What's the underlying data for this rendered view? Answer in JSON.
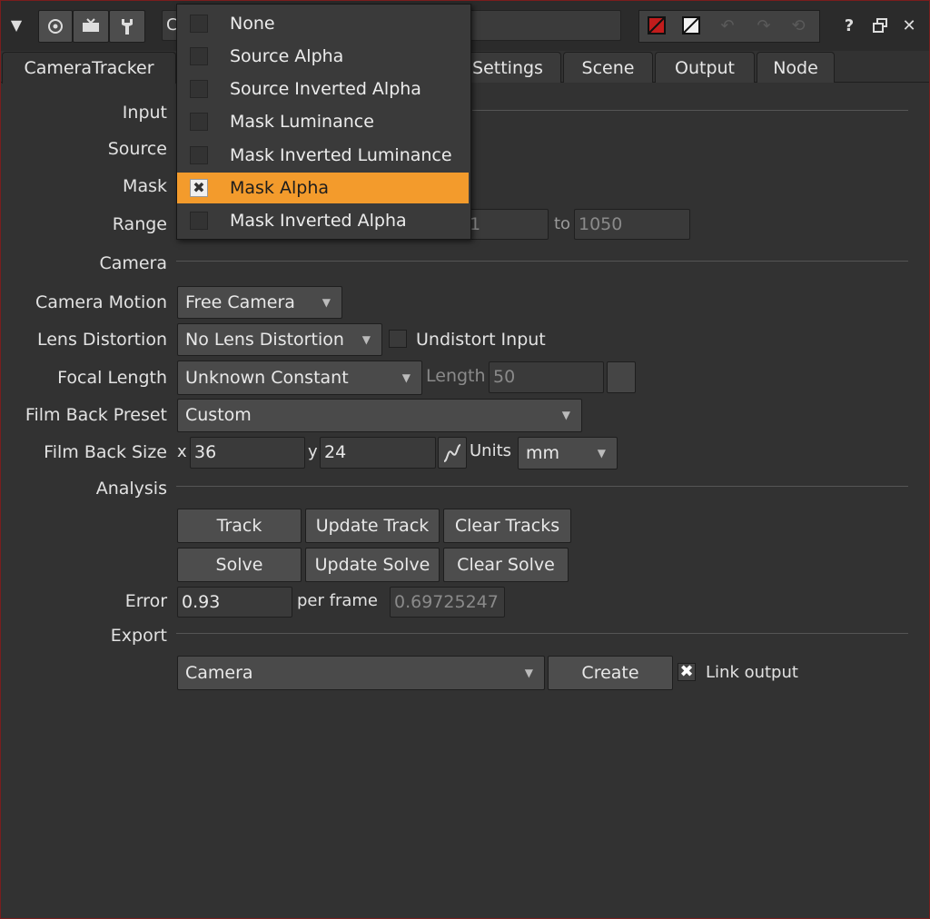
{
  "toolbar": {
    "node_name": "C",
    "icons": [
      "collapse-triangle-icon",
      "circle-target-icon",
      "tv-icon",
      "wrench-icon",
      "red-swatch-icon",
      "white-swatch-icon",
      "undo-icon",
      "redo-icon",
      "revert-icon",
      "help-icon",
      "float-icon",
      "close-icon"
    ],
    "help_label": "?",
    "close_label": "✕"
  },
  "tabs": [
    {
      "label": "CameraTracker",
      "active": true
    },
    {
      "label": "Settings",
      "active": false
    },
    {
      "label": "Scene",
      "active": false
    },
    {
      "label": "Output",
      "active": false
    },
    {
      "label": "Node",
      "active": false
    }
  ],
  "input_section": {
    "heading": "Input",
    "source_label": "Source",
    "mask_label": "Mask",
    "range_label": "Range",
    "range_from": "1",
    "range_to_label": "to",
    "range_to": "1050"
  },
  "mask_menu": {
    "items": [
      {
        "label": "None",
        "selected": false
      },
      {
        "label": "Source Alpha",
        "selected": false
      },
      {
        "label": "Source Inverted Alpha",
        "selected": false
      },
      {
        "label": "Mask Luminance",
        "selected": false
      },
      {
        "label": "Mask Inverted Luminance",
        "selected": false
      },
      {
        "label": "Mask Alpha",
        "selected": true
      },
      {
        "label": "Mask Inverted Alpha",
        "selected": false
      }
    ],
    "highlight_color": "#f39b2c"
  },
  "camera_section": {
    "heading": "Camera",
    "camera_motion_label": "Camera Motion",
    "camera_motion_value": "Free Camera",
    "lens_distortion_label": "Lens Distortion",
    "lens_distortion_value": "No Lens Distortion",
    "undistort_label": "Undistort Input",
    "undistort_checked": false,
    "focal_length_label": "Focal Length",
    "focal_length_value": "Unknown Constant",
    "length_label": "Length",
    "length_value": "50",
    "film_back_preset_label": "Film Back Preset",
    "film_back_preset_value": "Custom",
    "film_back_size_label": "Film Back Size",
    "x_label": "x",
    "x_value": "36",
    "y_label": "y",
    "y_value": "24",
    "units_label": "Units",
    "units_value": "mm"
  },
  "analysis_section": {
    "heading": "Analysis",
    "track_label": "Track",
    "update_track_label": "Update Track",
    "clear_tracks_label": "Clear Tracks",
    "solve_label": "Solve",
    "update_solve_label": "Update Solve",
    "clear_solve_label": "Clear Solve",
    "error_label": "Error",
    "error_value": "0.93",
    "per_frame_label": "per frame",
    "per_frame_value": "0.69725247"
  },
  "export_section": {
    "heading": "Export",
    "export_value": "Camera",
    "create_label": "Create",
    "link_output_label": "Link output",
    "link_output_checked": true
  }
}
